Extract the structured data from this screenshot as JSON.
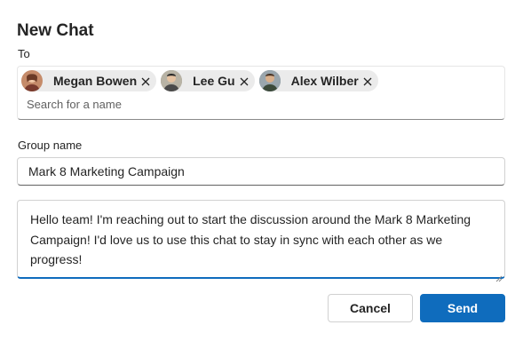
{
  "dialog": {
    "title": "New Chat",
    "to_label": "To",
    "recipients": [
      {
        "name": "Megan Bowen",
        "avatar_color": "#c58b6a"
      },
      {
        "name": "Lee Gu",
        "avatar_color": "#8d8a80"
      },
      {
        "name": "Alex Wilber",
        "avatar_color": "#6f7c8a"
      }
    ],
    "search_placeholder": "Search for a name",
    "group_label": "Group name",
    "group_value": "Mark 8 Marketing Campaign",
    "message": "Hello team! I'm reaching out to start the discussion around the Mark 8 Marketing Campaign! I'd love us to use this chat to stay in sync with each other as we progress!",
    "cancel_label": "Cancel",
    "send_label": "Send"
  },
  "colors": {
    "accent": "#0f6cbd",
    "chip_background": "#ebebeb"
  },
  "icons": {
    "remove": "close-icon"
  }
}
